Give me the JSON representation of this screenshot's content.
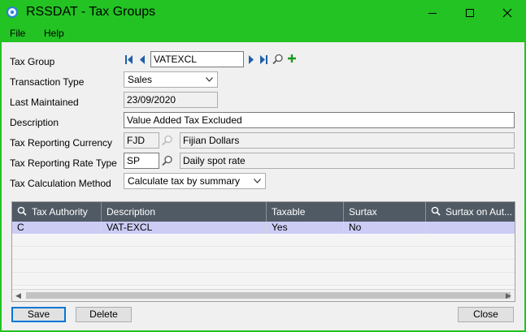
{
  "window": {
    "title": "RSSDAT - Tax Groups",
    "controls": {
      "minimize": "—",
      "maximize": "☐",
      "close": "✕"
    }
  },
  "menu": {
    "file": "File",
    "help": "Help"
  },
  "form": {
    "tax_group": {
      "label": "Tax Group",
      "value": "VATEXCL"
    },
    "transaction_type": {
      "label": "Transaction Type",
      "value": "Sales"
    },
    "last_maintained": {
      "label": "Last Maintained",
      "value": "23/09/2020"
    },
    "description": {
      "label": "Description",
      "value": "Value Added Tax Excluded"
    },
    "tax_reporting_currency": {
      "label": "Tax Reporting Currency",
      "code": "FJD",
      "name": "Fijian Dollars"
    },
    "tax_reporting_rate_type": {
      "label": "Tax Reporting Rate Type",
      "code": "SP",
      "name": "Daily spot rate"
    },
    "tax_calculation_method": {
      "label": "Tax Calculation Method",
      "value": "Calculate tax by summary"
    }
  },
  "grid": {
    "columns": [
      "Tax Authority",
      "Description",
      "Taxable",
      "Surtax",
      "Surtax on Aut..."
    ],
    "rows": [
      {
        "tax_authority": "C",
        "description": "VAT-EXCL",
        "taxable": "Yes",
        "surtax": "No",
        "surtax_on_auth": ""
      }
    ]
  },
  "buttons": {
    "save": "Save",
    "delete": "Delete",
    "close": "Close"
  },
  "colors": {
    "titlebar": "#22c322",
    "grid_header": "#505a64",
    "selected_row": "#ccccf5",
    "nav_arrow": "#1e5fa8",
    "add_icon": "#1b9a1b"
  },
  "icons": [
    "app-icon",
    "first-record-icon",
    "previous-record-icon",
    "next-record-icon",
    "last-record-icon",
    "search-icon",
    "add-icon",
    "chevron-down-icon"
  ]
}
